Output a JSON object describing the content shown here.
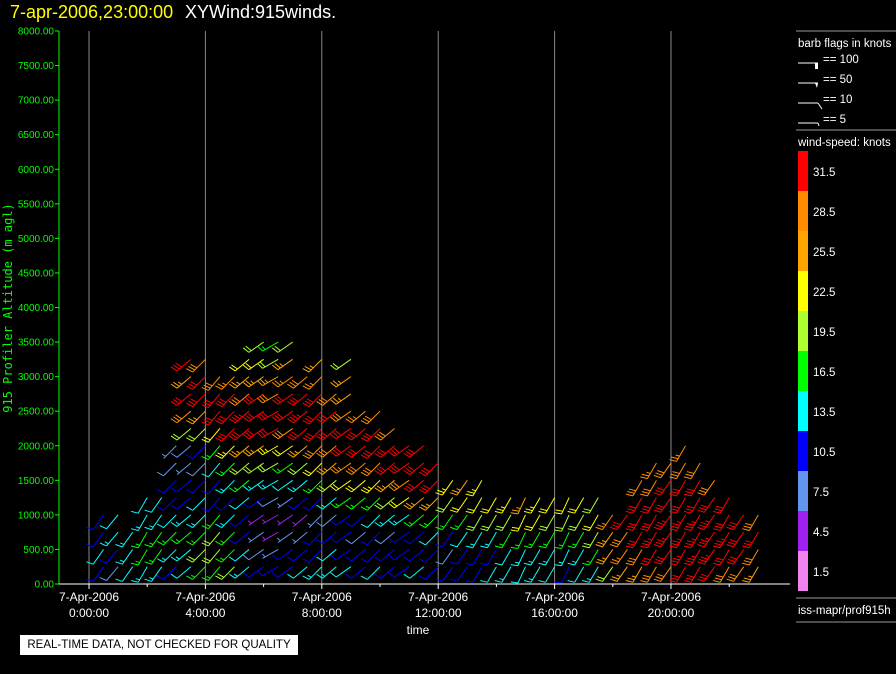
{
  "header": {
    "datetime": "7-apr-2006,23:00:00",
    "product": "XYWind:915winds."
  },
  "notice": "REAL-TIME DATA, NOT CHECKED FOR QUALITY",
  "legend": {
    "barb_title": "barb flags in knots",
    "barb_flags": [
      "== 100",
      "== 50",
      "== 10",
      "== 5"
    ],
    "colorbar_title": "wind-speed: knots",
    "source": "iss-mapr/prof915h"
  },
  "chart_data": {
    "type": "wind-barb",
    "xlabel": "time",
    "ylabel": "915 Profiler Altitude (m agl)",
    "ylim": [
      0,
      8000
    ],
    "yticks": [
      "0.00",
      "500.00",
      "1000.00",
      "1500.00",
      "2000.00",
      "2500.00",
      "3000.00",
      "3500.00",
      "4000.00",
      "4500.00",
      "5000.00",
      "5500.00",
      "6000.00",
      "6500.00",
      "7000.00",
      "7500.00",
      "8000.00"
    ],
    "xlim_hours": [
      -1,
      24
    ],
    "xticks": [
      {
        "date": "7-Apr-2006",
        "time": "0:00:00"
      },
      {
        "date": "7-Apr-2006",
        "time": "4:00:00"
      },
      {
        "date": "7-Apr-2006",
        "time": "8:00:00"
      },
      {
        "date": "7-Apr-2006",
        "time": "12:00:00"
      },
      {
        "date": "7-Apr-2006",
        "time": "16:00:00"
      },
      {
        "date": "7-Apr-2006",
        "time": "20:00:00"
      }
    ],
    "grid": "vertical",
    "colorbar": {
      "labels": [
        "31.5",
        "28.5",
        "25.5",
        "22.5",
        "19.5",
        "16.5",
        "13.5",
        "10.5",
        "7.5",
        "4.5",
        "1.5"
      ],
      "colors": [
        "#ff0000",
        "#ff8c00",
        "#ffa500",
        "#ffff00",
        "#adff2f",
        "#00ff00",
        "#00ffff",
        "#0000ff",
        "#6495ed",
        "#a020f0",
        "#ee82ee"
      ]
    },
    "altitude_start_m": 250,
    "altitude_step_m": 250,
    "profiles": [
      {
        "time": "00:30",
        "dir": 215,
        "speeds": [
          10,
          12,
          11,
          9
        ]
      },
      {
        "time": "01:00",
        "dir": 220,
        "speeds": [
          8,
          11,
          13,
          12
        ]
      },
      {
        "time": "01:30",
        "dir": 215,
        "speeds": [
          12,
          14,
          13
        ]
      },
      {
        "time": "02:00",
        "dir": 210,
        "speeds": [
          14,
          16,
          15,
          13,
          12
        ]
      },
      {
        "time": "02:30",
        "dir": 215,
        "speeds": [
          13,
          15,
          17,
          14,
          12
        ]
      },
      {
        "time": "03:00",
        "dir": 225,
        "speeds": [
          11,
          13,
          16,
          12,
          10,
          9,
          8,
          7
        ]
      },
      {
        "time": "03:30",
        "dir": 230,
        "speeds": [
          12,
          14,
          15,
          13,
          10,
          9,
          6,
          8,
          20,
          28,
          30,
          26,
          31
        ]
      },
      {
        "time": "04:00",
        "dir": 225,
        "speeds": [
          16,
          18,
          17,
          14,
          12,
          10,
          8,
          10,
          18,
          26,
          31,
          30,
          29
        ]
      },
      {
        "time": "04:30",
        "dir": 220,
        "speeds": [
          17,
          20,
          19,
          15,
          11,
          9,
          12,
          16,
          22,
          31,
          32,
          28
        ]
      },
      {
        "time": "05:00",
        "dir": 225,
        "speeds": [
          18,
          16,
          15,
          14,
          10,
          13,
          17,
          23,
          30,
          32,
          31,
          27
        ]
      },
      {
        "time": "05:30",
        "dir": 230,
        "speeds": [
          14,
          12,
          10,
          9,
          12,
          15,
          20,
          26,
          32,
          33,
          28,
          25,
          22
        ]
      },
      {
        "time": "06:00",
        "dir": 235,
        "speeds": [
          10,
          8,
          6,
          5,
          9,
          14,
          19,
          24,
          31,
          32,
          30,
          26,
          22,
          20
        ]
      },
      {
        "time": "06:30",
        "dir": 240,
        "speeds": [
          9,
          7,
          5,
          4,
          8,
          13,
          18,
          23,
          30,
          31,
          29,
          25,
          20,
          15
        ]
      },
      {
        "time": "07:00",
        "dir": 235,
        "speeds": [
          11,
          9,
          6,
          3,
          7,
          12,
          17,
          22,
          28,
          31,
          30,
          27,
          24,
          19
        ]
      },
      {
        "time": "07:30",
        "dir": 230,
        "speeds": [
          12,
          10,
          7,
          5,
          9,
          14,
          19,
          25,
          31,
          33,
          32,
          29
        ]
      },
      {
        "time": "08:00",
        "dir": 225,
        "speeds": [
          13,
          11,
          9,
          7,
          11,
          16,
          22,
          28,
          32,
          31,
          30,
          27,
          25
        ]
      },
      {
        "time": "08:30",
        "dir": 230,
        "speeds": [
          14,
          12,
          10,
          8,
          13,
          18,
          24,
          29,
          31,
          30,
          28
        ]
      },
      {
        "time": "09:00",
        "dir": 235,
        "speeds": [
          12,
          11,
          9,
          10,
          15,
          21,
          27,
          31,
          32,
          29,
          26,
          24,
          20
        ]
      },
      {
        "time": "09:30",
        "dir": 230,
        "speeds": [
          11,
          10,
          8,
          11,
          16,
          22,
          28,
          31,
          30,
          27
        ]
      },
      {
        "time": "10:00",
        "dir": 225,
        "speeds": [
          12,
          10,
          9,
          12,
          17,
          23,
          29,
          32,
          31,
          28
        ]
      },
      {
        "time": "10:30",
        "dir": 230,
        "speeds": [
          10,
          9,
          8,
          13,
          19,
          26,
          31,
          32,
          29
        ]
      },
      {
        "time": "11:00",
        "dir": 235,
        "speeds": [
          11,
          10,
          9,
          14,
          21,
          28,
          32,
          31
        ]
      },
      {
        "time": "11:30",
        "dir": 230,
        "speeds": [
          12,
          10,
          11,
          16,
          24,
          31,
          32,
          30
        ]
      },
      {
        "time": "12:00",
        "dir": 225,
        "speeds": [
          10,
          9,
          12,
          17,
          25,
          31,
          30
        ]
      },
      {
        "time": "12:30",
        "dir": 215,
        "speeds": [
          9,
          8,
          11,
          16,
          20,
          23
        ]
      },
      {
        "time": "13:00",
        "dir": 215,
        "speeds": [
          10,
          9,
          12,
          17,
          21,
          24
        ]
      },
      {
        "time": "13:30",
        "dir": 210,
        "speeds": [
          11,
          10,
          13,
          18,
          22,
          23
        ]
      },
      {
        "time": "14:00",
        "dir": 210,
        "speeds": [
          12,
          11,
          14,
          19,
          22
        ]
      },
      {
        "time": "14:30",
        "dir": 210,
        "speeds": [
          13,
          12,
          15,
          20,
          23
        ]
      },
      {
        "time": "15:00",
        "dir": 205,
        "speeds": [
          12,
          13,
          16,
          21,
          24
        ]
      },
      {
        "time": "15:30",
        "dir": 210,
        "speeds": [
          13,
          14,
          17,
          22,
          23
        ]
      },
      {
        "time": "16:00",
        "dir": 210,
        "speeds": [
          12,
          14,
          16,
          20,
          22
        ]
      },
      {
        "time": "16:30",
        "dir": 205,
        "speeds": [
          11,
          13,
          16,
          19,
          21
        ]
      },
      {
        "time": "17:00",
        "dir": 210,
        "speeds": [
          12,
          14,
          17,
          20,
          22
        ]
      },
      {
        "time": "17:30",
        "dir": 210,
        "speeds": [
          13,
          15,
          18,
          21,
          20
        ]
      },
      {
        "time": "18:00",
        "dir": 215,
        "speeds": [
          20,
          24,
          26,
          27
        ]
      },
      {
        "time": "18:30",
        "dir": 215,
        "speeds": [
          24,
          27,
          29,
          30
        ]
      },
      {
        "time": "19:00",
        "dir": 210,
        "speeds": [
          26,
          29,
          31,
          32,
          30,
          28
        ]
      },
      {
        "time": "19:30",
        "dir": 210,
        "speeds": [
          28,
          31,
          33,
          32,
          31,
          29,
          27
        ]
      },
      {
        "time": "20:00",
        "dir": 215,
        "speeds": [
          29,
          32,
          34,
          33,
          31,
          30,
          28
        ]
      },
      {
        "time": "20:30",
        "dir": 210,
        "speeds": [
          30,
          33,
          35,
          34,
          32,
          30,
          29,
          27
        ]
      },
      {
        "time": "21:00",
        "dir": 210,
        "speeds": [
          31,
          34,
          35,
          33,
          32,
          31,
          28
        ]
      },
      {
        "time": "21:30",
        "dir": 215,
        "speeds": [
          30,
          33,
          34,
          33,
          31,
          29
        ]
      },
      {
        "time": "22:00",
        "dir": 210,
        "speeds": [
          29,
          32,
          33,
          31,
          30
        ]
      },
      {
        "time": "22:30",
        "dir": 215,
        "speeds": [
          28,
          31,
          32,
          30
        ]
      },
      {
        "time": "23:00",
        "dir": 210,
        "speeds": [
          26,
          29,
          30,
          28
        ]
      }
    ]
  }
}
